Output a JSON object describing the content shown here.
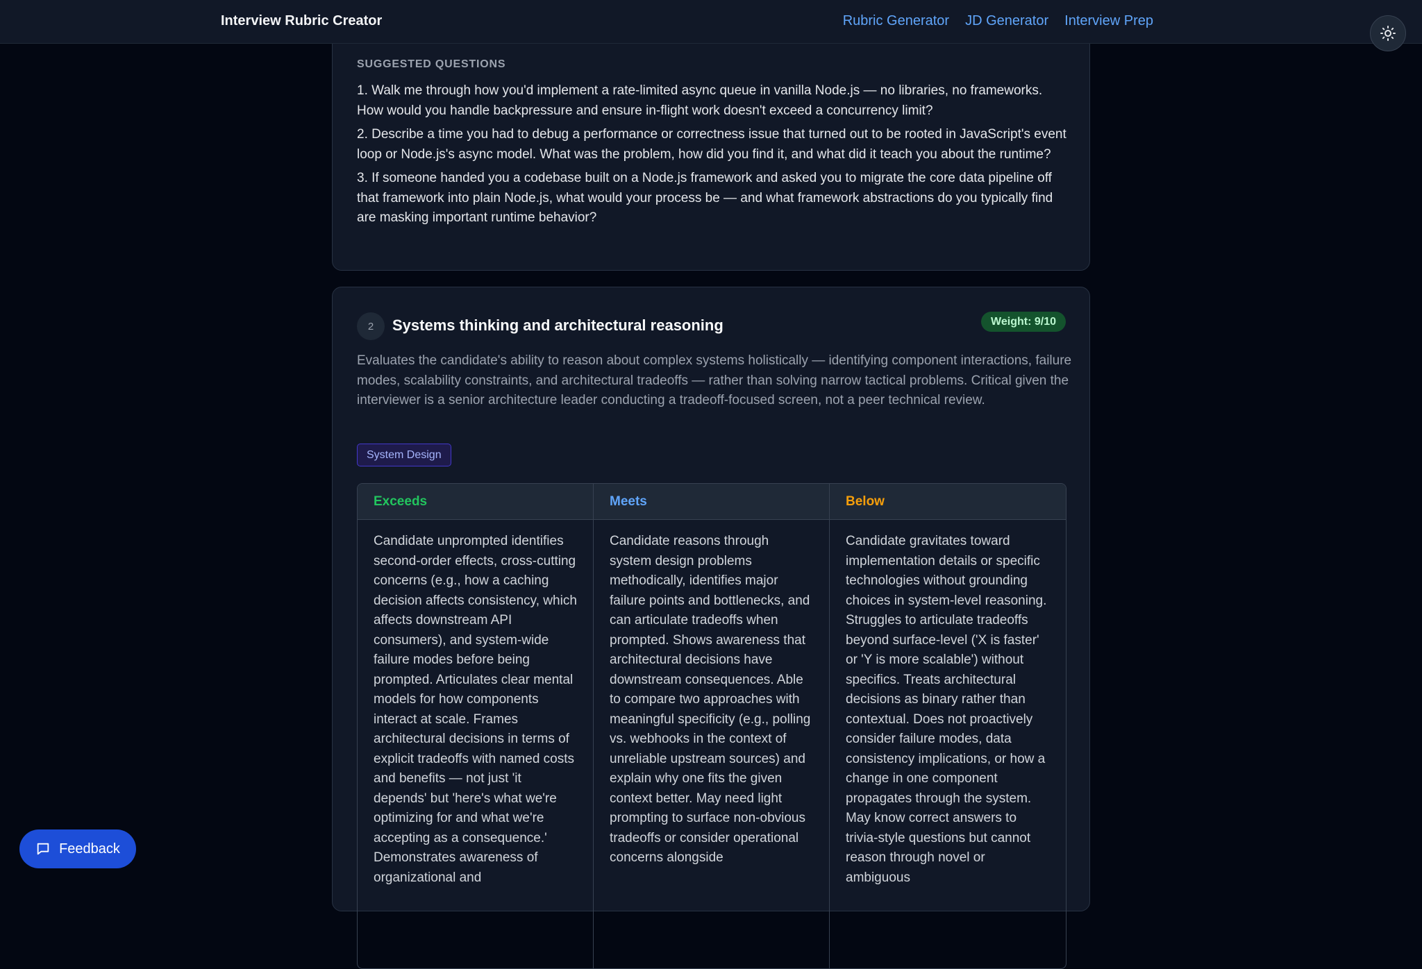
{
  "header": {
    "app_title": "Interview Rubric Creator",
    "nav": [
      "Rubric Generator",
      "JD Generator",
      "Interview Prep"
    ]
  },
  "questions_section": {
    "label": "SUGGESTED QUESTIONS",
    "items": [
      "1. Walk me through how you'd implement a rate-limited async queue in vanilla Node.js — no libraries, no frameworks. How would you handle backpressure and ensure in-flight work doesn't exceed a concurrency limit?",
      "2. Describe a time you had to debug a performance or correctness issue that turned out to be rooted in JavaScript's event loop or Node.js's async model. What was the problem, how did you find it, and what did it teach you about the runtime?",
      "3. If someone handed you a codebase built on a Node.js framework and asked you to migrate the core data pipeline off that framework into plain Node.js, what would your process be — and what framework abstractions do you typically find are masking important runtime behavior?"
    ]
  },
  "criterion": {
    "number": "2",
    "title": "Systems thinking and architectural reasoning",
    "weight": "Weight: 9/10",
    "description": "Evaluates the candidate's ability to reason about complex systems holistically — identifying component interactions, failure modes, scalability constraints, and architectural tradeoffs — rather than solving narrow tactical problems. Critical given the interviewer is a senior architecture leader conducting a tradeoff-focused screen, not a peer technical review.",
    "tag": "System Design",
    "levels": [
      {
        "label": "Exceeds",
        "color": "#22c55e",
        "text": "Candidate unprompted identifies second-order effects, cross-cutting concerns (e.g., how a caching decision affects consistency, which affects downstream API consumers), and system-wide failure modes before being prompted. Articulates clear mental models for how components interact at scale. Frames architectural decisions in terms of explicit tradeoffs with named costs and benefits — not just 'it depends' but 'here's what we're optimizing for and what we're accepting as a consequence.' Demonstrates awareness of organizational and"
      },
      {
        "label": "Meets",
        "color": "#60a5fa",
        "text": "Candidate reasons through system design problems methodically, identifies major failure points and bottlenecks, and can articulate tradeoffs when prompted. Shows awareness that architectural decisions have downstream consequences. Able to compare two approaches with meaningful specificity (e.g., polling vs. webhooks in the context of unreliable upstream sources) and explain why one fits the given context better. May need light prompting to surface non-obvious tradeoffs or consider operational concerns alongside"
      },
      {
        "label": "Below",
        "color": "#f59e0b",
        "text": "Candidate gravitates toward implementation details or specific technologies without grounding choices in system-level reasoning. Struggles to articulate tradeoffs beyond surface-level ('X is faster' or 'Y is more scalable') without specifics. Treats architectural decisions as binary rather than contextual. Does not proactively consider failure modes, data consistency implications, or how a change in one component propagates through the system. May know correct answers to trivia-style questions but cannot reason through novel or ambiguous"
      }
    ]
  },
  "feedback_button": {
    "label": "Feedback"
  }
}
